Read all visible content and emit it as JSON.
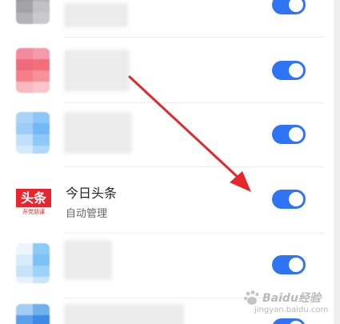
{
  "app_row": {
    "icon_text": "头条",
    "icon_tagline": "开党朋课",
    "name": "今日头条",
    "status": "自动管理"
  },
  "watermark": {
    "main": "Baidu经验",
    "sub": "jingyan.baidu.com"
  },
  "colors": {
    "toggle_on": "#2f74f5",
    "annotation_arrow": "#e6272a",
    "toutiao_red": "#e8242e"
  },
  "toggles": {
    "count": 6,
    "all_enabled": true
  }
}
